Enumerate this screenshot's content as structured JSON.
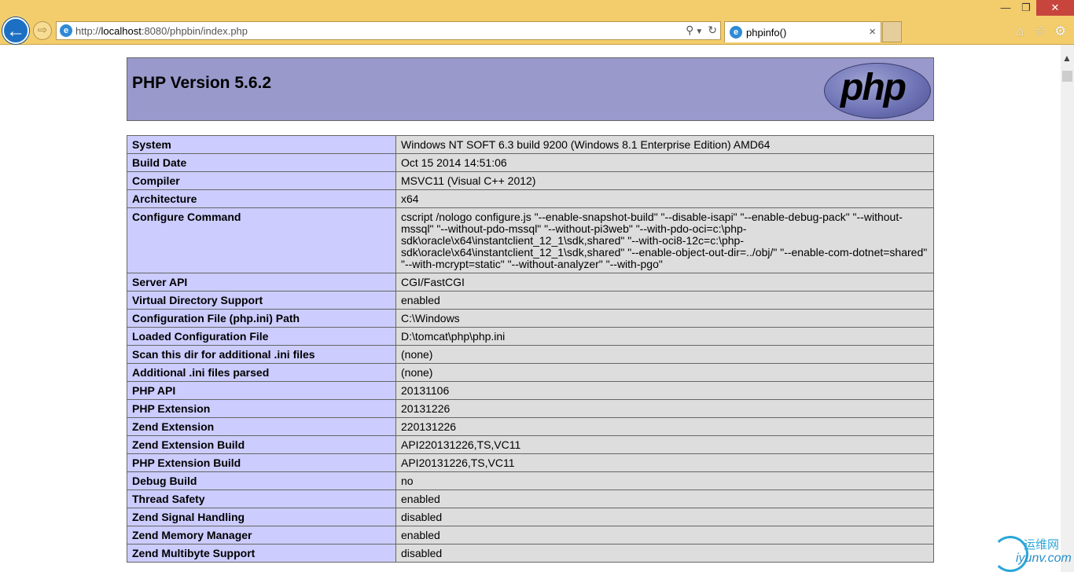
{
  "browser": {
    "url_prefix": "http://",
    "url_host": "localhost",
    "url_rest": ":8080/phpbin/index.php",
    "tab_title": "phpinfo()",
    "close_glyph": "×",
    "win_min": "—",
    "win_max": "❐",
    "win_close": "✕"
  },
  "page": {
    "heading": "PHP Version 5.6.2",
    "logo_text": "php"
  },
  "rows": [
    {
      "key": "System",
      "value": "Windows NT SOFT 6.3 build 9200 (Windows 8.1 Enterprise Edition) AMD64"
    },
    {
      "key": "Build Date",
      "value": "Oct 15 2014 14:51:06"
    },
    {
      "key": "Compiler",
      "value": "MSVC11 (Visual C++ 2012)"
    },
    {
      "key": "Architecture",
      "value": "x64"
    },
    {
      "key": "Configure Command",
      "value": "cscript /nologo configure.js \"--enable-snapshot-build\" \"--disable-isapi\" \"--enable-debug-pack\" \"--without-mssql\" \"--without-pdo-mssql\" \"--without-pi3web\" \"--with-pdo-oci=c:\\php-sdk\\oracle\\x64\\instantclient_12_1\\sdk,shared\" \"--with-oci8-12c=c:\\php-sdk\\oracle\\x64\\instantclient_12_1\\sdk,shared\" \"--enable-object-out-dir=../obj/\" \"--enable-com-dotnet=shared\" \"--with-mcrypt=static\" \"--without-analyzer\" \"--with-pgo\""
    },
    {
      "key": "Server API",
      "value": "CGI/FastCGI"
    },
    {
      "key": "Virtual Directory Support",
      "value": "enabled"
    },
    {
      "key": "Configuration File (php.ini) Path",
      "value": "C:\\Windows"
    },
    {
      "key": "Loaded Configuration File",
      "value": "D:\\tomcat\\php\\php.ini"
    },
    {
      "key": "Scan this dir for additional .ini files",
      "value": "(none)"
    },
    {
      "key": "Additional .ini files parsed",
      "value": "(none)"
    },
    {
      "key": "PHP API",
      "value": "20131106"
    },
    {
      "key": "PHP Extension",
      "value": "20131226"
    },
    {
      "key": "Zend Extension",
      "value": "220131226"
    },
    {
      "key": "Zend Extension Build",
      "value": "API220131226,TS,VC11"
    },
    {
      "key": "PHP Extension Build",
      "value": "API20131226,TS,VC11"
    },
    {
      "key": "Debug Build",
      "value": "no"
    },
    {
      "key": "Thread Safety",
      "value": "enabled"
    },
    {
      "key": "Zend Signal Handling",
      "value": "disabled"
    },
    {
      "key": "Zend Memory Manager",
      "value": "enabled"
    },
    {
      "key": "Zend Multibyte Support",
      "value": "disabled"
    }
  ],
  "watermark": {
    "cn": "运维网",
    "en": "iyunv.com"
  },
  "colors": {
    "header": "#9999cc",
    "key_cell": "#ccccff",
    "value_cell": "#dddddd",
    "chrome": "#f3cd6c"
  }
}
